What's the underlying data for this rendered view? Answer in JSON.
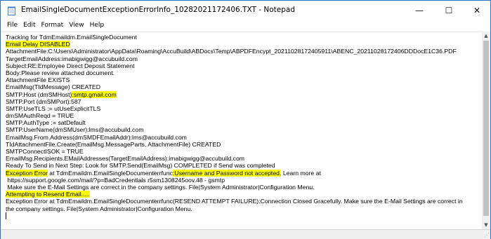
{
  "window": {
    "title": "EmailSingleDocumentExceptionErrorInfo_10282021172406.TXT - Notepad",
    "controls": {
      "minimize": "—",
      "maximize": "☐",
      "close": "✕"
    }
  },
  "menu": {
    "items": [
      "File",
      "Edit",
      "Format",
      "View",
      "Help"
    ]
  },
  "editor": {
    "lines": [
      [
        {
          "t": "Tracking for TdmEmaildm.EmailSingleDocument"
        }
      ],
      [
        {
          "t": "Email Delay DISABLED",
          "hl": true
        }
      ],
      [
        {
          "t": "AttachmentFile:C:\\Users\\Administrator\\AppData\\Roaming\\AccuBuild\\ABDocs\\Temp\\ABPDFEncypt_20211028172405911\\ABENC_20211028172406DDDocE1C36.PDF"
        }
      ],
      [
        {
          "t": "TargetEmailAddress:imabigwigg@accubuild.com"
        }
      ],
      [
        {
          "t": "Subject:RE:Employee Direct Deposit Statement"
        }
      ],
      [
        {
          "t": "Body:Please review attached document."
        }
      ],
      [
        {
          "t": "AttachmentFile EXISTS"
        }
      ],
      [
        {
          "t": "EmailMsg(TIdMessage) CREATED"
        }
      ],
      [
        {
          "t": "SMTP.Host (dmSMHost)"
        },
        {
          "t": ":smtp.gmail.com",
          "hl": true
        }
      ],
      [
        {
          "t": "SMTP.Port (dmSMPort):587"
        }
      ],
      [
        {
          "t": "SMTP.UseTLS := utUseExplicitTLS"
        }
      ],
      [
        {
          "t": "dmSMAuthReqd = TRUE"
        }
      ],
      [
        {
          "t": "SMTP.AuthType := satDefault"
        }
      ],
      [
        {
          "t": "SMTP.UserName(dmSMUser):lms@accubuild.com"
        }
      ],
      [
        {
          "t": "EmailMsg.From.Address(dmSMDFEmailAddr):lms@accubuild.com"
        }
      ],
      [
        {
          "t": "TIdAttachmentFile.Create(EmailMsg.MessageParts, AttachmentFile) CREATED"
        }
      ],
      [
        {
          "t": "SMTPConnectISOK = TRUE"
        }
      ],
      [
        {
          "t": "EmailMsg.Recipients.EMailAddresses(TargetEmailAddress):imabigwigg@accubuild.com"
        }
      ],
      [
        {
          "t": "Ready To Send in Next Step: Look for SMTP.Send(EmailMsg) COMPLETED if Send was completed"
        }
      ],
      [
        {
          "t": "Exception Error",
          "hl": true
        },
        {
          "t": " at TdmEmaildm.EmailSingleDocumenterrfunc"
        },
        {
          "t": ":Username and Password not accepted.",
          "hl": true
        },
        {
          "t": " Learn more at"
        }
      ],
      [
        {
          "t": " https://support.google.com/mail/?p=BadCredentials r5sm1308245oov.48 - gsmtp"
        }
      ],
      [
        {
          "t": " Make sure the E-Mail Settings are correct in the company settings. File|System Administrator|Configuration Menu."
        }
      ],
      [
        {
          "t": "Attempting to Resend Email.....",
          "hl": true
        }
      ],
      [
        {
          "t": "Exception Error at TdmEmaildm.EmailSingleDocumenterrfunc(RESEND ATTEMPT FAILURE):Connection Closed Gracefully. Make sure the E-Mail Settings are correct in"
        }
      ],
      [
        {
          "t": "the company settings. File|System Administrator|Configuration Menu."
        }
      ],
      [
        {
          "t": "",
          "caret": true
        }
      ]
    ]
  },
  "colors": {
    "highlight": "#ffff00",
    "window_border": "#2b73c6"
  },
  "icons": {
    "app": "notepad-icon",
    "scroll_up": "chevron-up-icon",
    "scroll_down": "chevron-down-icon"
  }
}
